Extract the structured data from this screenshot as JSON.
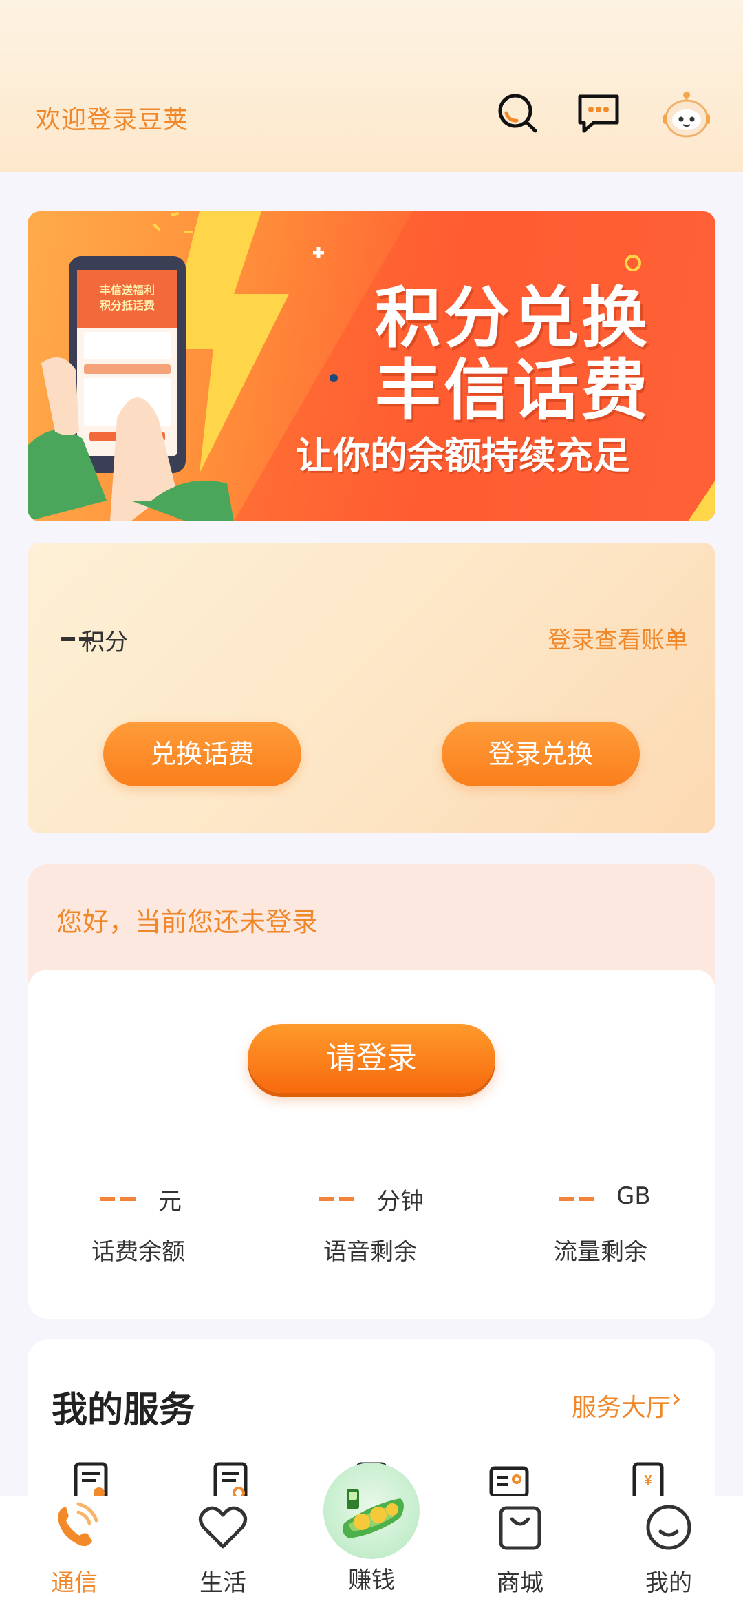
{
  "header": {
    "welcome_text": "欢迎登录豆荚",
    "icons": [
      "search-icon",
      "message-icon",
      "robot-avatar-icon"
    ]
  },
  "banner": {
    "line1": "积分兑换",
    "line2": "丰信话费",
    "line3": "让你的余额持续充足",
    "phone_caption_1": "丰信送福利",
    "phone_caption_2": "积分抵话费"
  },
  "points": {
    "value": "--",
    "label": "积分",
    "bill_link": "登录查看账单",
    "exchange_button": "兑换话费",
    "login_exchange_button": "登录兑换"
  },
  "login_card": {
    "hello": "您好，当前您还未登录",
    "login_button": "请登录",
    "stats": [
      {
        "value": "--",
        "unit": "元",
        "label": "话费余额"
      },
      {
        "value": "--",
        "unit": "分钟",
        "label": "语音剩余"
      },
      {
        "value": "--",
        "unit": "GB",
        "label": "流量剩余"
      }
    ]
  },
  "services": {
    "title": "我的服务",
    "link": "服务大厅"
  },
  "tabbar": {
    "items": [
      {
        "label": "通信",
        "icon": "phone-icon",
        "active": true
      },
      {
        "label": "生活",
        "icon": "heart-icon",
        "active": false
      },
      {
        "label": "赚钱",
        "icon": "pea-mascot-icon",
        "active": false
      },
      {
        "label": "商城",
        "icon": "shopping-bag-icon",
        "active": false
      },
      {
        "label": "我的",
        "icon": "smile-face-icon",
        "active": false
      }
    ]
  },
  "colors": {
    "accent": "#f0882a",
    "button_orange": "#fa7f1c",
    "banner_red": "#ff5f32"
  }
}
